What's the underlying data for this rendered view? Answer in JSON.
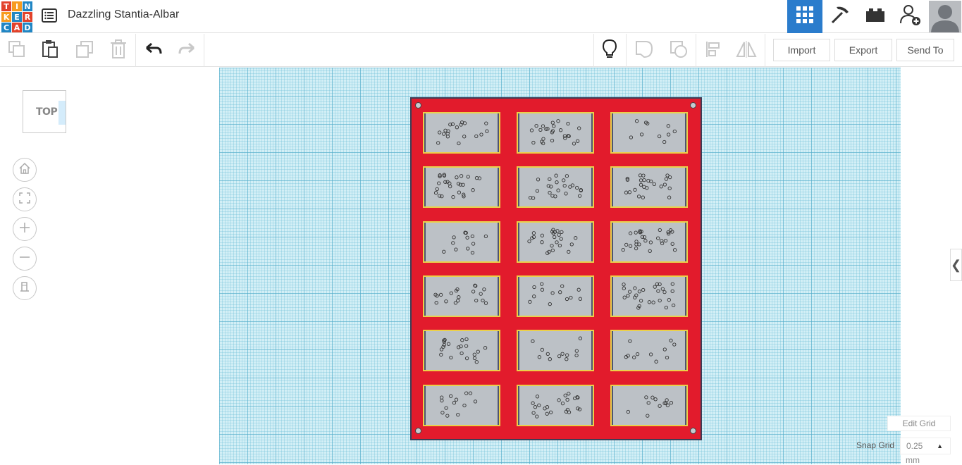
{
  "app": {
    "logo_letters": [
      "T",
      "I",
      "N",
      "K",
      "E",
      "R",
      "C",
      "A",
      "D"
    ],
    "title": "Dazzling Stantia-Albar"
  },
  "header": {
    "buttons": [
      {
        "name": "3d-design-view",
        "icon": "grid-icon",
        "active": true
      },
      {
        "name": "codeblocks-view",
        "icon": "pickaxe-icon",
        "active": false
      },
      {
        "name": "bricks-view",
        "icon": "brick-icon",
        "active": false
      },
      {
        "name": "invite-user",
        "icon": "add-user-icon",
        "active": false
      }
    ]
  },
  "toolbar": {
    "import_label": "Import",
    "export_label": "Export",
    "send_to_label": "Send To"
  },
  "viewcube": {
    "label": "TOP"
  },
  "right_panel": {
    "edit_grid_label": "Edit Grid",
    "snap_grid_label": "Snap Grid",
    "snap_grid_value": "0.25",
    "snap_grid_unit": "mm"
  },
  "colors": {
    "accent": "#2a7ccc",
    "board": "#e21b2c",
    "cell_border": "#ebd04a",
    "cell_fill": "#bcc1c6",
    "grid": "#d3eff6"
  }
}
